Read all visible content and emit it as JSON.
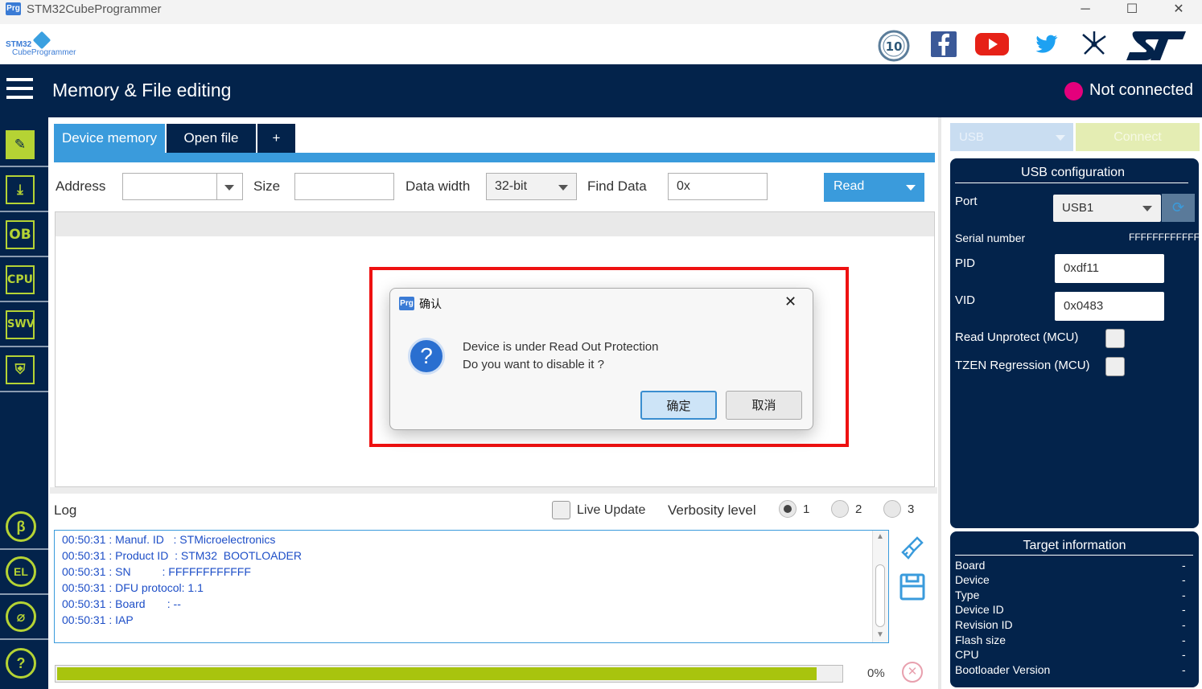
{
  "window": {
    "icon_label": "Prg",
    "title": "STM32CubeProgrammer",
    "minimize": "─",
    "maximize": "☐",
    "close": "✕"
  },
  "brand": {
    "logo_line1": "STM32",
    "logo_line2": "CubeProgrammer",
    "social_icons": [
      "anniversary-10-icon",
      "facebook-icon",
      "youtube-icon",
      "twitter-icon",
      "network-icon",
      "st-logo-icon"
    ],
    "anniversary_text": "10"
  },
  "header": {
    "page_title": "Memory & File editing",
    "connection_status": "Not connected",
    "status_color": "#e4007c"
  },
  "left_nav": {
    "items": [
      {
        "name": "memory-edit-icon",
        "glyph": "✎",
        "active": true
      },
      {
        "name": "download-icon",
        "glyph": "⤓",
        "active": false
      },
      {
        "name": "ob",
        "glyph": "OB",
        "active": false
      },
      {
        "name": "cpu",
        "glyph": "CPU",
        "active": false
      },
      {
        "name": "swv",
        "glyph": "SWV",
        "active": false
      },
      {
        "name": "security-shield-icon",
        "glyph": "⛨",
        "active": false
      }
    ],
    "bottom_items": [
      {
        "name": "beta-icon",
        "glyph": "β"
      },
      {
        "name": "el-icon",
        "glyph": "EL"
      },
      {
        "name": "plugin-icon",
        "glyph": "⌀"
      },
      {
        "name": "help-icon",
        "glyph": "?"
      }
    ]
  },
  "tabs": [
    {
      "label": "Device memory",
      "active": true
    },
    {
      "label": "Open file",
      "active": false
    },
    {
      "label": "+",
      "active": false
    }
  ],
  "toolbar": {
    "address_label": "Address",
    "address_value": "",
    "size_label": "Size",
    "size_value": "",
    "data_width_label": "Data width",
    "data_width_value": "32-bit",
    "find_data_label": "Find Data",
    "find_data_value": "0x",
    "read_button": "Read"
  },
  "log": {
    "label": "Log",
    "live_update_label": "Live Update",
    "verbosity_label": "Verbosity level",
    "verbosity_options": [
      "1",
      "2",
      "3"
    ],
    "verbosity_selected": "1",
    "lines": [
      "00:50:31 : Manuf. ID   : STMicroelectronics",
      "00:50:31 : Product ID  : STM32  BOOTLOADER",
      "00:50:31 : SN          : FFFFFFFFFFFF",
      "00:50:31 : DFU protocol: 1.1",
      "00:50:31 : Board       : --",
      "00:50:31 : IAP"
    ],
    "progress_percent": 0,
    "progress_text": "0%",
    "progress_fill_fraction": 1.0
  },
  "right": {
    "interface_select": "USB",
    "connect_button": "Connect",
    "usb_config": {
      "title": "USB configuration",
      "port_label": "Port",
      "port_value": "USB1",
      "serial_label": "Serial number",
      "serial_value": "FFFFFFFFFFFF",
      "pid_label": "PID",
      "pid_value": "0xdf11",
      "vid_label": "VID",
      "vid_value": "0x0483",
      "read_unprotect_label": "Read Unprotect (MCU)",
      "tzen_label": "TZEN Regression (MCU)"
    },
    "target_info": {
      "title": "Target information",
      "rows": [
        {
          "label": "Board",
          "value": "-"
        },
        {
          "label": "Device",
          "value": "-"
        },
        {
          "label": "Type",
          "value": "-"
        },
        {
          "label": "Device ID",
          "value": "-"
        },
        {
          "label": "Revision ID",
          "value": "-"
        },
        {
          "label": "Flash size",
          "value": "-"
        },
        {
          "label": "CPU",
          "value": "-"
        },
        {
          "label": "Bootloader Version",
          "value": "-"
        }
      ]
    }
  },
  "dialog": {
    "icon_label": "Prg",
    "title": "确认",
    "close": "✕",
    "question_glyph": "?",
    "message_line1": "Device is under Read Out Protection",
    "message_line2": "Do you want to disable it ?",
    "ok_button": "确定",
    "cancel_button": "取消"
  }
}
